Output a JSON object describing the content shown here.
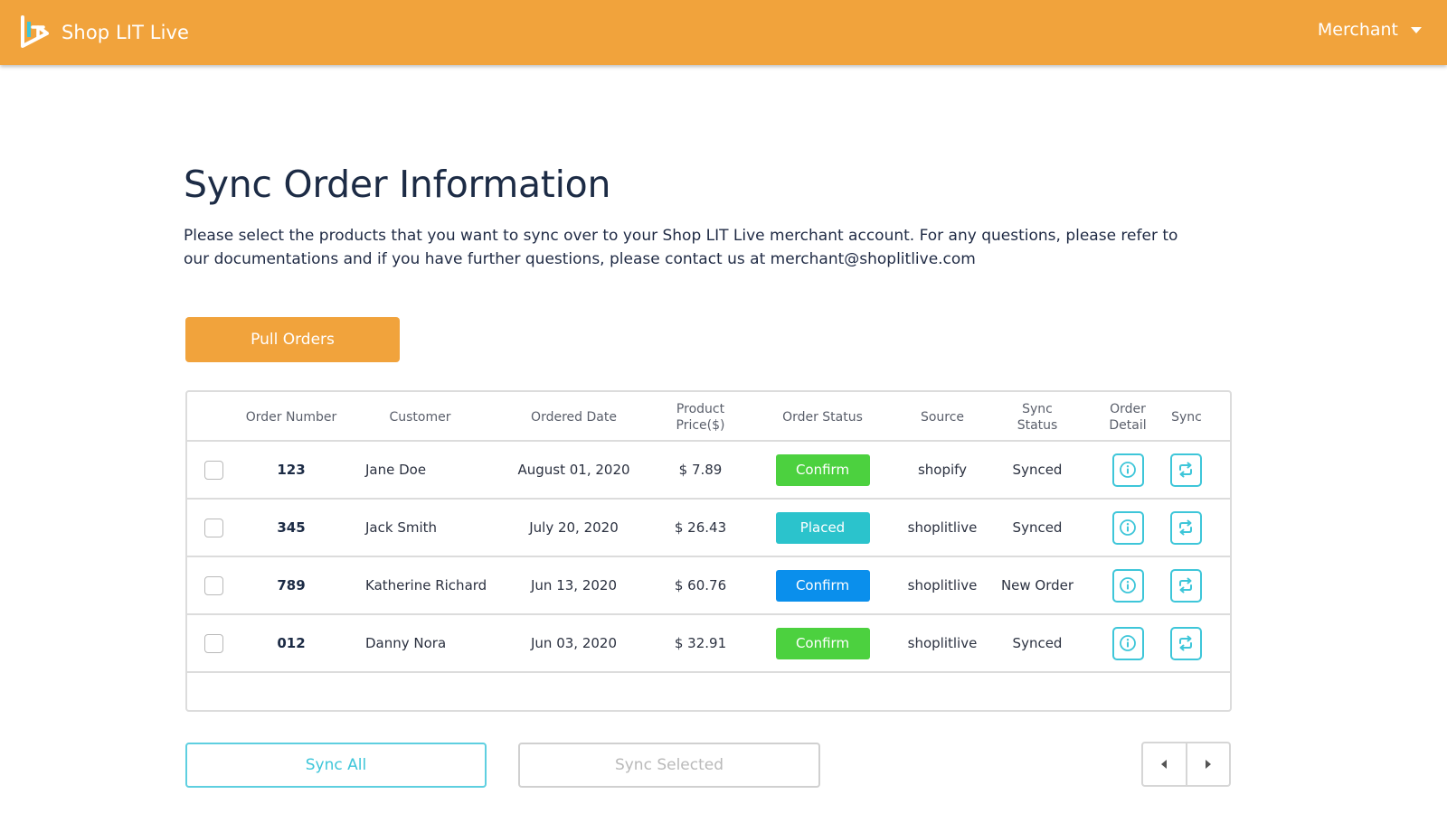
{
  "app": {
    "name": "Shop LIT Live",
    "user_menu_label": "Merchant"
  },
  "page": {
    "title": "Sync Order Information",
    "description": "Please select the products that you want to sync over to your Shop LIT Live merchant account. For any questions, please refer to our documentations and if you have further questions, please contact us at merchant@shoplitlive.com",
    "pull_button_label": "Pull Orders"
  },
  "table": {
    "columns": [
      {
        "key": "select",
        "label": ""
      },
      {
        "key": "order_number",
        "label": "Order Number"
      },
      {
        "key": "customer",
        "label": "Customer"
      },
      {
        "key": "ordered_date",
        "label": "Ordered Date"
      },
      {
        "key": "price",
        "label": "Product Price($)"
      },
      {
        "key": "order_status",
        "label": "Order Status"
      },
      {
        "key": "source",
        "label": "Source"
      },
      {
        "key": "sync_status",
        "label": "Sync Status"
      },
      {
        "key": "order_detail",
        "label": "Order Detail"
      },
      {
        "key": "sync",
        "label": "Sync"
      }
    ],
    "header_lines": {
      "price": [
        "Product",
        "Price($)"
      ],
      "sync_status": [
        "Sync",
        "Status"
      ],
      "order_detail": [
        "Order",
        "Detail"
      ]
    },
    "rows": [
      {
        "checked": false,
        "order_number": "123",
        "customer": "Jane Doe",
        "ordered_date": "August 01, 2020",
        "price": "$ 7.89",
        "order_status": "Confirm",
        "order_status_color": "#4cd13f",
        "source": "shopify",
        "sync_status": "Synced",
        "detail_icon": "info-icon",
        "sync_icon": "sync-icon"
      },
      {
        "checked": false,
        "order_number": "345",
        "customer": "Jack Smith",
        "ordered_date": "July 20, 2020",
        "price": "$ 26.43",
        "order_status": "Placed",
        "order_status_color": "#2bc3cc",
        "source": "shoplitlive",
        "sync_status": "Synced",
        "detail_icon": "info-icon",
        "sync_icon": "sync-icon"
      },
      {
        "checked": false,
        "order_number": "789",
        "customer": "Katherine Richard",
        "ordered_date": "Jun 13, 2020",
        "price": "$ 60.76",
        "order_status": "Confirm",
        "order_status_color": "#0a8fec",
        "source": "shoplitlive",
        "sync_status": "New Order",
        "detail_icon": "info-icon",
        "sync_icon": "sync-icon"
      },
      {
        "checked": false,
        "order_number": "012",
        "customer": "Danny Nora",
        "ordered_date": "Jun 03, 2020",
        "price": "$ 32.91",
        "order_status": "Confirm",
        "order_status_color": "#4cd13f",
        "source": "shoplitlive",
        "sync_status": "Synced",
        "detail_icon": "info-icon",
        "sync_icon": "sync-icon"
      }
    ]
  },
  "footer": {
    "sync_all_label": "Sync All",
    "sync_selected_label": "Sync Selected",
    "prev_icon": "caret-left-icon",
    "next_icon": "caret-right-icon"
  },
  "colors": {
    "brand": "#f1a33c",
    "accent": "#3ec6d9",
    "status_confirm_green": "#4cd13f",
    "status_placed_teal": "#2bc3cc",
    "status_confirm_blue": "#0a8fec"
  }
}
